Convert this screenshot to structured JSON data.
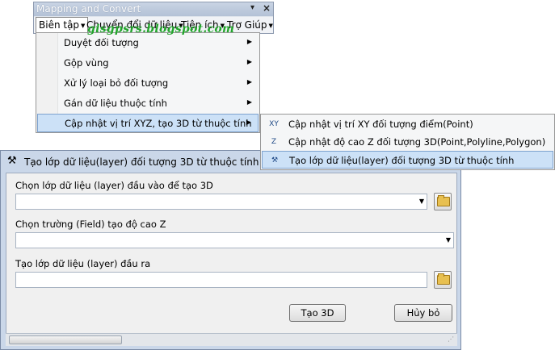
{
  "toolbar": {
    "title": "Mapping and Convert",
    "pin_glyph": "▾",
    "close_glyph": "×",
    "menus": [
      {
        "label": "Biên tập"
      },
      {
        "label": "Chuyển đổi dữ liệu"
      },
      {
        "label": "Tiện ích"
      },
      {
        "label": "Trợ Giúp"
      }
    ]
  },
  "watermark": "gisgpsrs.blogspot.com",
  "dropdown": {
    "items": [
      {
        "label": "Duyệt đối tượng"
      },
      {
        "label": "Gộp vùng"
      },
      {
        "label": "Xử lý loại bỏ đối tượng"
      },
      {
        "label": "Gán dữ liệu thuộc tính"
      },
      {
        "label": "Cập nhật vị trí XYZ, tạo 3D từ thuộc tính"
      }
    ],
    "highlighted_index": 4
  },
  "submenu": {
    "items": [
      {
        "label": "Cập nhật vị trí XY đối tượng điểm(Point)",
        "icon": "xy-icon",
        "glyph": "XY"
      },
      {
        "label": "Cập nhật độ cao Z đối tượng 3D(Point,Polyline,Polygon)",
        "icon": "z-icon",
        "glyph": "Z"
      },
      {
        "label": "Tạo lớp dữ liệu(layer) đối tượng 3D từ thuộc tính",
        "icon": "hammer-icon",
        "glyph": "⚒"
      }
    ],
    "highlighted_index": 2
  },
  "dialog": {
    "title": "Tạo lớp dữ liệu(layer) đối tượng 3D từ thuộc tính",
    "title_glyph": "⚒",
    "input_layer_label": "Chọn lớp dữ liệu (layer) đầu vào để tạo 3D",
    "input_layer_value": "",
    "z_field_label": "Chọn trường (Field) tạo độ cao Z",
    "z_field_value": "",
    "output_layer_label": "Tạo lớp dữ liệu (layer) đầu ra",
    "output_layer_value": "",
    "create_button": "Tạo 3D",
    "cancel_button": "Hủy bỏ"
  },
  "colors": {
    "menu_highlight": "#cce1f7",
    "dialog_frame": "#cad7e9",
    "watermark": "#22a52b"
  }
}
